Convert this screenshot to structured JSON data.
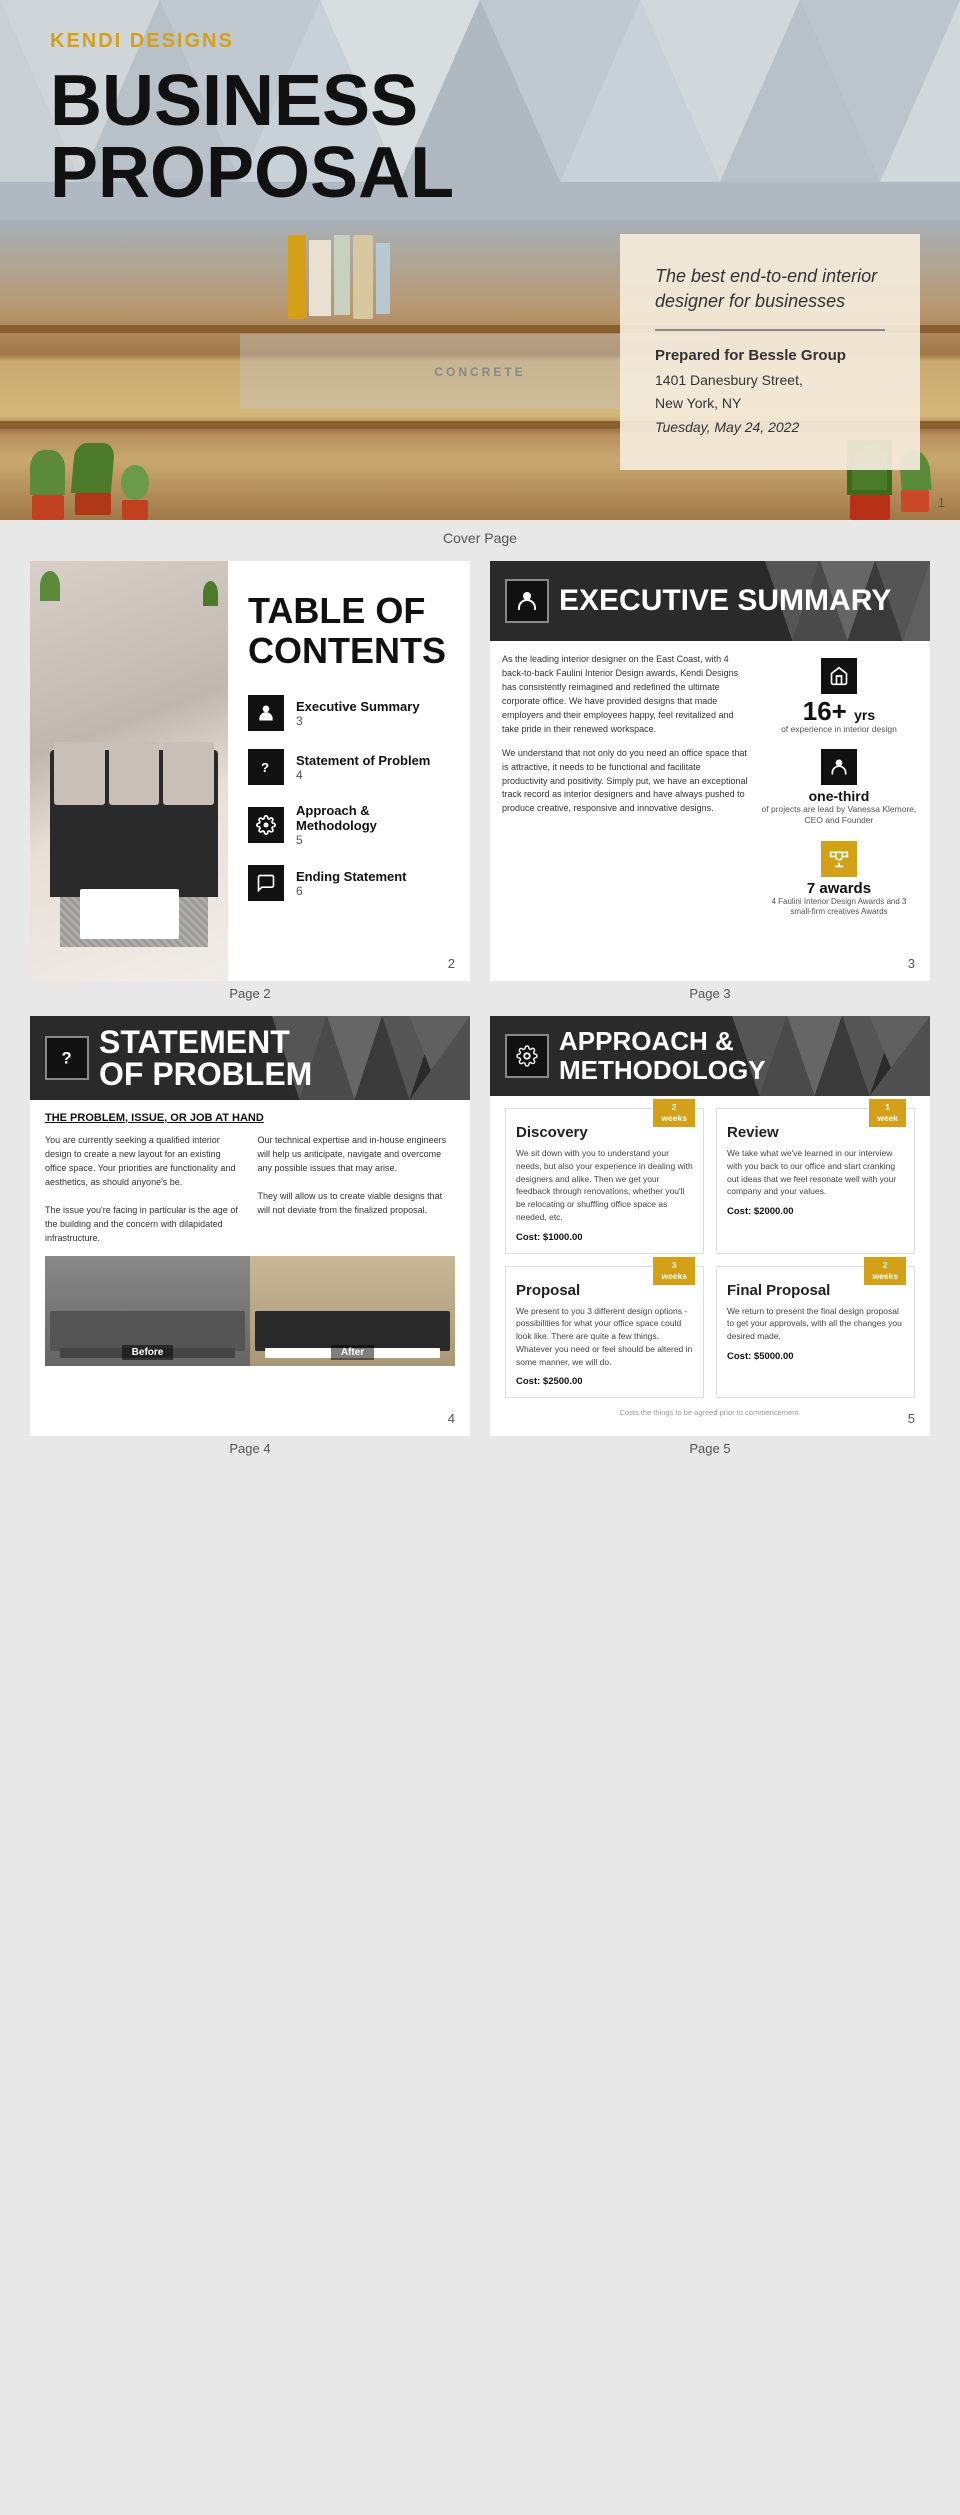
{
  "brand": {
    "name": "KENDI DESIGNS"
  },
  "cover": {
    "title_line1": "BUSINESS",
    "title_line2": "PROPOSAL",
    "tagline": "The best end-to-end interior designer for businesses",
    "prepared_label": "Prepared for Bessle Group",
    "address_line1": "1401 Danesbury Street,",
    "address_line2": "New York, NY",
    "date": "Tuesday, May 24, 2022",
    "page_number": "1",
    "label": "Cover Page"
  },
  "toc": {
    "title_line1": "TABLE OF",
    "title_line2": "CONTENTS",
    "items": [
      {
        "name": "Executive Summary",
        "page": "3",
        "icon": "person"
      },
      {
        "name": "Statement of Problem",
        "page": "4",
        "icon": "question"
      },
      {
        "name": "Approach & Methodology",
        "page": "5",
        "icon": "gear"
      },
      {
        "name": "Ending Statement",
        "page": "6",
        "icon": "speech"
      }
    ],
    "page_number": "2",
    "label": "Page 2"
  },
  "executive_summary": {
    "title": "EXECUTIVE SUMMARY",
    "body_para1": "As the leading interior designer on the East Coast, with 4 back-to-back Faulini Interior Design awards, Kendi Designs has consistently reimagined and redefined the ultimate corporate office. We have provided designs that made employers and their employees happy, feel revitalized and take pride in their renewed workspace.",
    "body_para2": "We understand that not only do you need an office space that is attractive, it needs to be functional and facilitate productivity and positivity. Simply put, we have an exceptional track record as interior designers and have always pushed to produce creative, responsive and innovative designs.",
    "stats": [
      {
        "value": "16+",
        "unit": "yrs",
        "label": "of experience in interior design",
        "icon": "house"
      },
      {
        "value": "one-third",
        "unit": "",
        "label": "of projects are lead by Vanessa Klemore, CEO and Founder",
        "icon": "person"
      },
      {
        "value": "7 awards",
        "unit": "",
        "label": "4 Faulini Interior Design Awards and 3 small-firm creatives Awards",
        "icon": "trophy"
      }
    ],
    "page_number": "3",
    "label": "Page 3"
  },
  "statement_of_problem": {
    "title_line1": "STATEMENT",
    "title_line2": "OF PROBLEM",
    "subheading": "THE PROBLEM, ISSUE, OR JOB AT HAND",
    "col1_text": "You are currently seeking a qualified interior design to create a new layout for an existing office space. Your priorities are functionality and aesthetics, as should anyone's be.\n\nThe issue you're facing in particular is the age of the building and the concern with dilapidated infrastructure.",
    "col2_text": "Our technical expertise and in-house engineers will help us anticipate, navigate and overcome any possible issues that may arise.\n\nThey will allow us to create viable designs that will not deviate from the finalized proposal.",
    "before_label": "Before",
    "after_label": "After",
    "page_number": "4",
    "label": "Page 4"
  },
  "approach": {
    "title_line1": "APPROACH &",
    "title_line2": "METHODOLOGY",
    "cards": [
      {
        "title": "Discovery",
        "weeks": "2\nweeks",
        "text": "We sit down with you to understand your needs, but also your experience in dealing with designers and alike. Then we get your feedback through renovations, whether you'll be relocating or shuffling office space as needed, etc.",
        "cost": "Cost: $1000.00"
      },
      {
        "title": "Review",
        "weeks": "1\nweek",
        "text": "We take what we've learned in our interview with you back to our office and start cranking out ideas that we feel resonate well with your company and your values.",
        "cost": "Cost: $2000.00"
      },
      {
        "title": "Proposal",
        "weeks": "3\nweeks",
        "text": "We present to you 3 different design options - possibilities for what your office space could look like. There are quite a few things. Whatever you need or feel should be altered in some manner, we will do.",
        "cost": "Cost: $2500.00"
      },
      {
        "title": "Final Proposal",
        "weeks": "2\nweeks",
        "text": "We return to present the final design proposal to get your approvals, with all the changes you desired made.",
        "cost": "Cost: $5000.00"
      }
    ],
    "caption": "Costs the things to be agreed prior to commencement.",
    "page_number": "5",
    "label": "Page 5"
  }
}
